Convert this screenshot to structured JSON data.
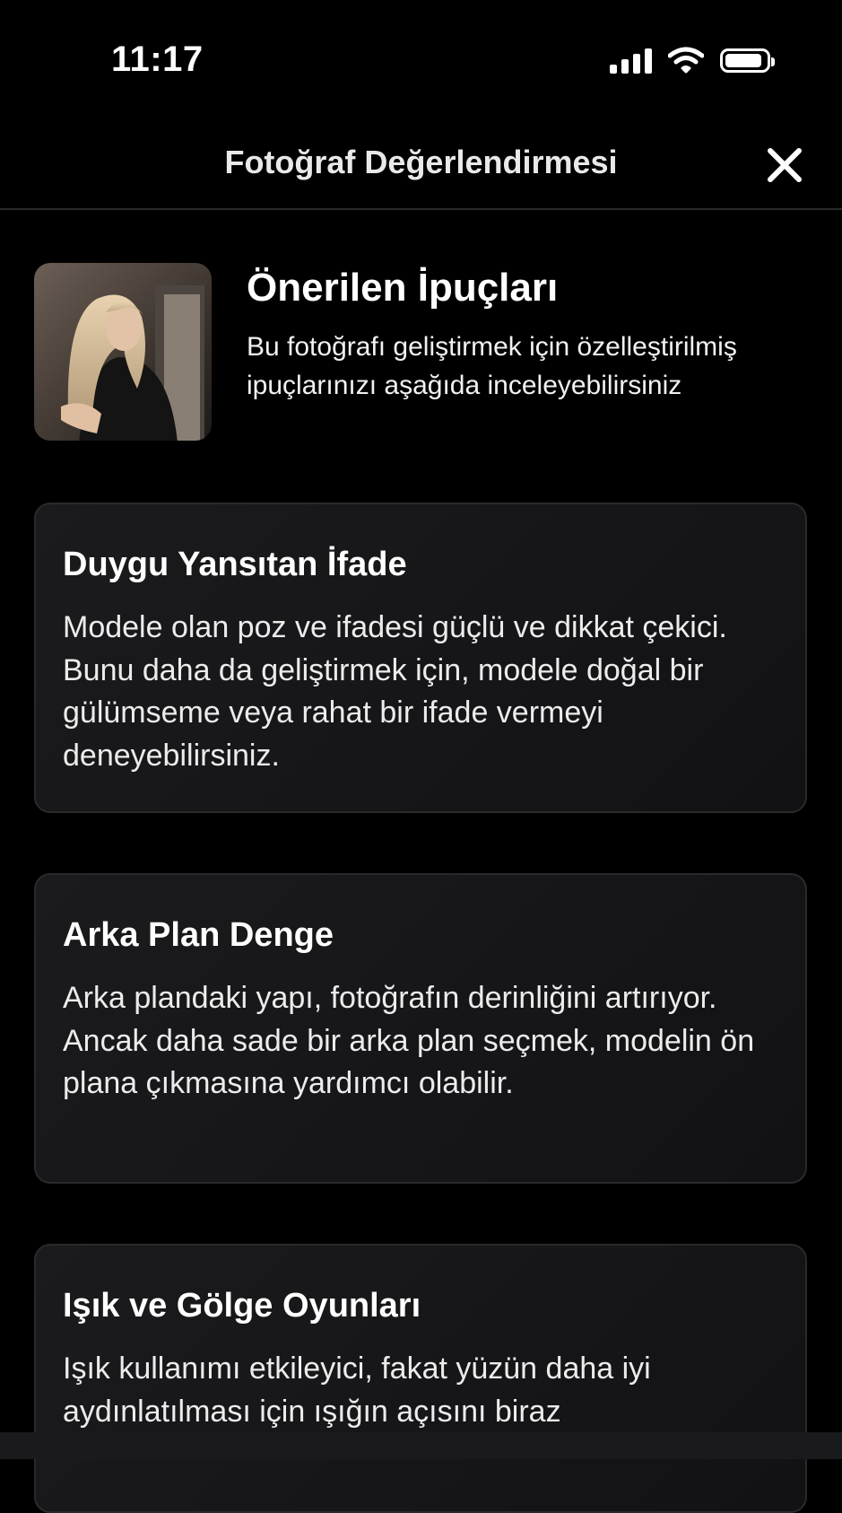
{
  "status_bar": {
    "time": "11:17"
  },
  "header": {
    "title": "Fotoğraf Değerlendirmesi",
    "close_icon": "close-icon"
  },
  "intro": {
    "title": "Önerilen İpuçları",
    "description": "Bu fotoğrafı geliştirmek için özelleştirilmiş ipuçlarınızı aşağıda inceleyebilirsiniz"
  },
  "tips": [
    {
      "title": "Duygu Yansıtan İfade",
      "body": "Modele olan poz ve ifadesi güçlü ve dikkat çekici. Bunu daha da geliştirmek için, modele doğal bir gülümseme veya rahat bir ifade vermeyi deneyebilirsiniz."
    },
    {
      "title": "Arka Plan Denge",
      "body": "Arka plandaki yapı, fotoğrafın derinliğini artırıyor. Ancak daha sade bir arka plan seçmek, modelin ön plana çıkmasına yardımcı olabilir."
    },
    {
      "title": "Işık ve Gölge Oyunları",
      "body": "Işık kullanımı etkileyici, fakat yüzün daha iyi aydınlatılması için ışığın açısını biraz"
    }
  ],
  "colors": {
    "background": "#000000",
    "card_background": "#1b1b1d",
    "card_border": "#2a2a2c",
    "text": "#ffffff"
  }
}
